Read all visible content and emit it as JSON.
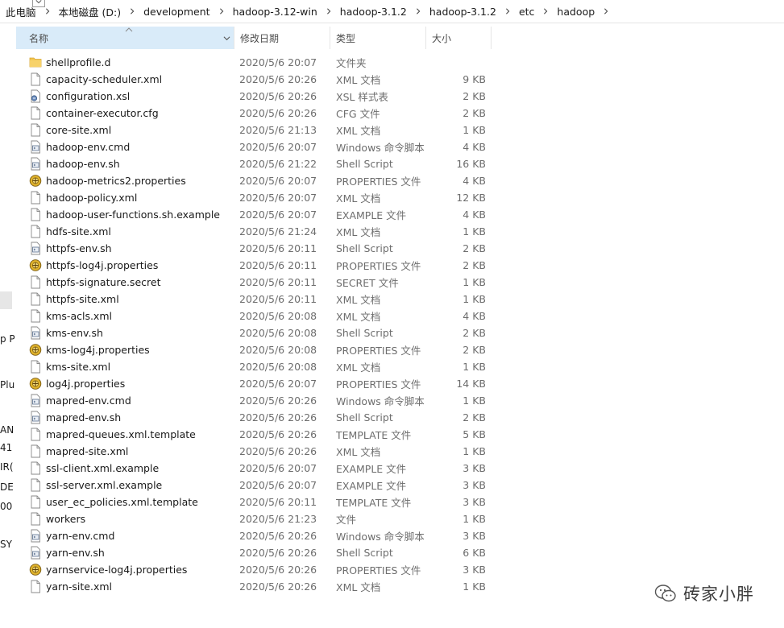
{
  "breadcrumb": [
    "此电脑",
    "本地磁盘 (D:)",
    "development",
    "hadoop-3.12-win",
    "hadoop-3.1.2",
    "hadoop-3.1.2",
    "etc",
    "hadoop"
  ],
  "columns": {
    "name": "名称",
    "date": "修改日期",
    "type": "类型",
    "size": "大小"
  },
  "left_fragments": [
    "p P",
    "Plu",
    "AN",
    "41",
    "IR(",
    "DEI",
    "00",
    "SY"
  ],
  "files": [
    {
      "name": "shellprofile.d",
      "date": "2020/5/6 20:07",
      "type": "文件夹",
      "size": "",
      "icon": "folder"
    },
    {
      "name": "capacity-scheduler.xml",
      "date": "2020/5/6 20:26",
      "type": "XML 文档",
      "size": "9 KB",
      "icon": "file"
    },
    {
      "name": "configuration.xsl",
      "date": "2020/5/6 20:26",
      "type": "XSL 样式表",
      "size": "2 KB",
      "icon": "xsl"
    },
    {
      "name": "container-executor.cfg",
      "date": "2020/5/6 20:26",
      "type": "CFG 文件",
      "size": "2 KB",
      "icon": "file"
    },
    {
      "name": "core-site.xml",
      "date": "2020/5/6 21:13",
      "type": "XML 文档",
      "size": "1 KB",
      "icon": "file"
    },
    {
      "name": "hadoop-env.cmd",
      "date": "2020/5/6 20:07",
      "type": "Windows 命令脚本",
      "size": "4 KB",
      "icon": "script"
    },
    {
      "name": "hadoop-env.sh",
      "date": "2020/5/6 21:22",
      "type": "Shell Script",
      "size": "16 KB",
      "icon": "script"
    },
    {
      "name": "hadoop-metrics2.properties",
      "date": "2020/5/6 20:07",
      "type": "PROPERTIES 文件",
      "size": "4 KB",
      "icon": "properties"
    },
    {
      "name": "hadoop-policy.xml",
      "date": "2020/5/6 20:07",
      "type": "XML 文档",
      "size": "12 KB",
      "icon": "file"
    },
    {
      "name": "hadoop-user-functions.sh.example",
      "date": "2020/5/6 20:07",
      "type": "EXAMPLE 文件",
      "size": "4 KB",
      "icon": "file"
    },
    {
      "name": "hdfs-site.xml",
      "date": "2020/5/6 21:24",
      "type": "XML 文档",
      "size": "1 KB",
      "icon": "file"
    },
    {
      "name": "httpfs-env.sh",
      "date": "2020/5/6 20:11",
      "type": "Shell Script",
      "size": "2 KB",
      "icon": "script"
    },
    {
      "name": "httpfs-log4j.properties",
      "date": "2020/5/6 20:11",
      "type": "PROPERTIES 文件",
      "size": "2 KB",
      "icon": "properties"
    },
    {
      "name": "httpfs-signature.secret",
      "date": "2020/5/6 20:11",
      "type": "SECRET 文件",
      "size": "1 KB",
      "icon": "file"
    },
    {
      "name": "httpfs-site.xml",
      "date": "2020/5/6 20:11",
      "type": "XML 文档",
      "size": "1 KB",
      "icon": "file"
    },
    {
      "name": "kms-acls.xml",
      "date": "2020/5/6 20:08",
      "type": "XML 文档",
      "size": "4 KB",
      "icon": "file"
    },
    {
      "name": "kms-env.sh",
      "date": "2020/5/6 20:08",
      "type": "Shell Script",
      "size": "2 KB",
      "icon": "script"
    },
    {
      "name": "kms-log4j.properties",
      "date": "2020/5/6 20:08",
      "type": "PROPERTIES 文件",
      "size": "2 KB",
      "icon": "properties"
    },
    {
      "name": "kms-site.xml",
      "date": "2020/5/6 20:08",
      "type": "XML 文档",
      "size": "1 KB",
      "icon": "file"
    },
    {
      "name": "log4j.properties",
      "date": "2020/5/6 20:07",
      "type": "PROPERTIES 文件",
      "size": "14 KB",
      "icon": "properties"
    },
    {
      "name": "mapred-env.cmd",
      "date": "2020/5/6 20:26",
      "type": "Windows 命令脚本",
      "size": "1 KB",
      "icon": "script"
    },
    {
      "name": "mapred-env.sh",
      "date": "2020/5/6 20:26",
      "type": "Shell Script",
      "size": "2 KB",
      "icon": "script"
    },
    {
      "name": "mapred-queues.xml.template",
      "date": "2020/5/6 20:26",
      "type": "TEMPLATE 文件",
      "size": "5 KB",
      "icon": "file"
    },
    {
      "name": "mapred-site.xml",
      "date": "2020/5/6 20:26",
      "type": "XML 文档",
      "size": "1 KB",
      "icon": "file"
    },
    {
      "name": "ssl-client.xml.example",
      "date": "2020/5/6 20:07",
      "type": "EXAMPLE 文件",
      "size": "3 KB",
      "icon": "file"
    },
    {
      "name": "ssl-server.xml.example",
      "date": "2020/5/6 20:07",
      "type": "EXAMPLE 文件",
      "size": "3 KB",
      "icon": "file"
    },
    {
      "name": "user_ec_policies.xml.template",
      "date": "2020/5/6 20:11",
      "type": "TEMPLATE 文件",
      "size": "3 KB",
      "icon": "file"
    },
    {
      "name": "workers",
      "date": "2020/5/6 21:23",
      "type": "文件",
      "size": "1 KB",
      "icon": "file"
    },
    {
      "name": "yarn-env.cmd",
      "date": "2020/5/6 20:26",
      "type": "Windows 命令脚本",
      "size": "3 KB",
      "icon": "script"
    },
    {
      "name": "yarn-env.sh",
      "date": "2020/5/6 20:26",
      "type": "Shell Script",
      "size": "6 KB",
      "icon": "script"
    },
    {
      "name": "yarnservice-log4j.properties",
      "date": "2020/5/6 20:26",
      "type": "PROPERTIES 文件",
      "size": "3 KB",
      "icon": "properties"
    },
    {
      "name": "yarn-site.xml",
      "date": "2020/5/6 20:26",
      "type": "XML 文档",
      "size": "1 KB",
      "icon": "file"
    }
  ],
  "watermark": {
    "text": "砖家小胖",
    "icon": "wechat-icon"
  },
  "colors": {
    "header_selected": "#d9ebf9",
    "folder": "#f3c44e",
    "meta_text": "#6d6d6d"
  }
}
